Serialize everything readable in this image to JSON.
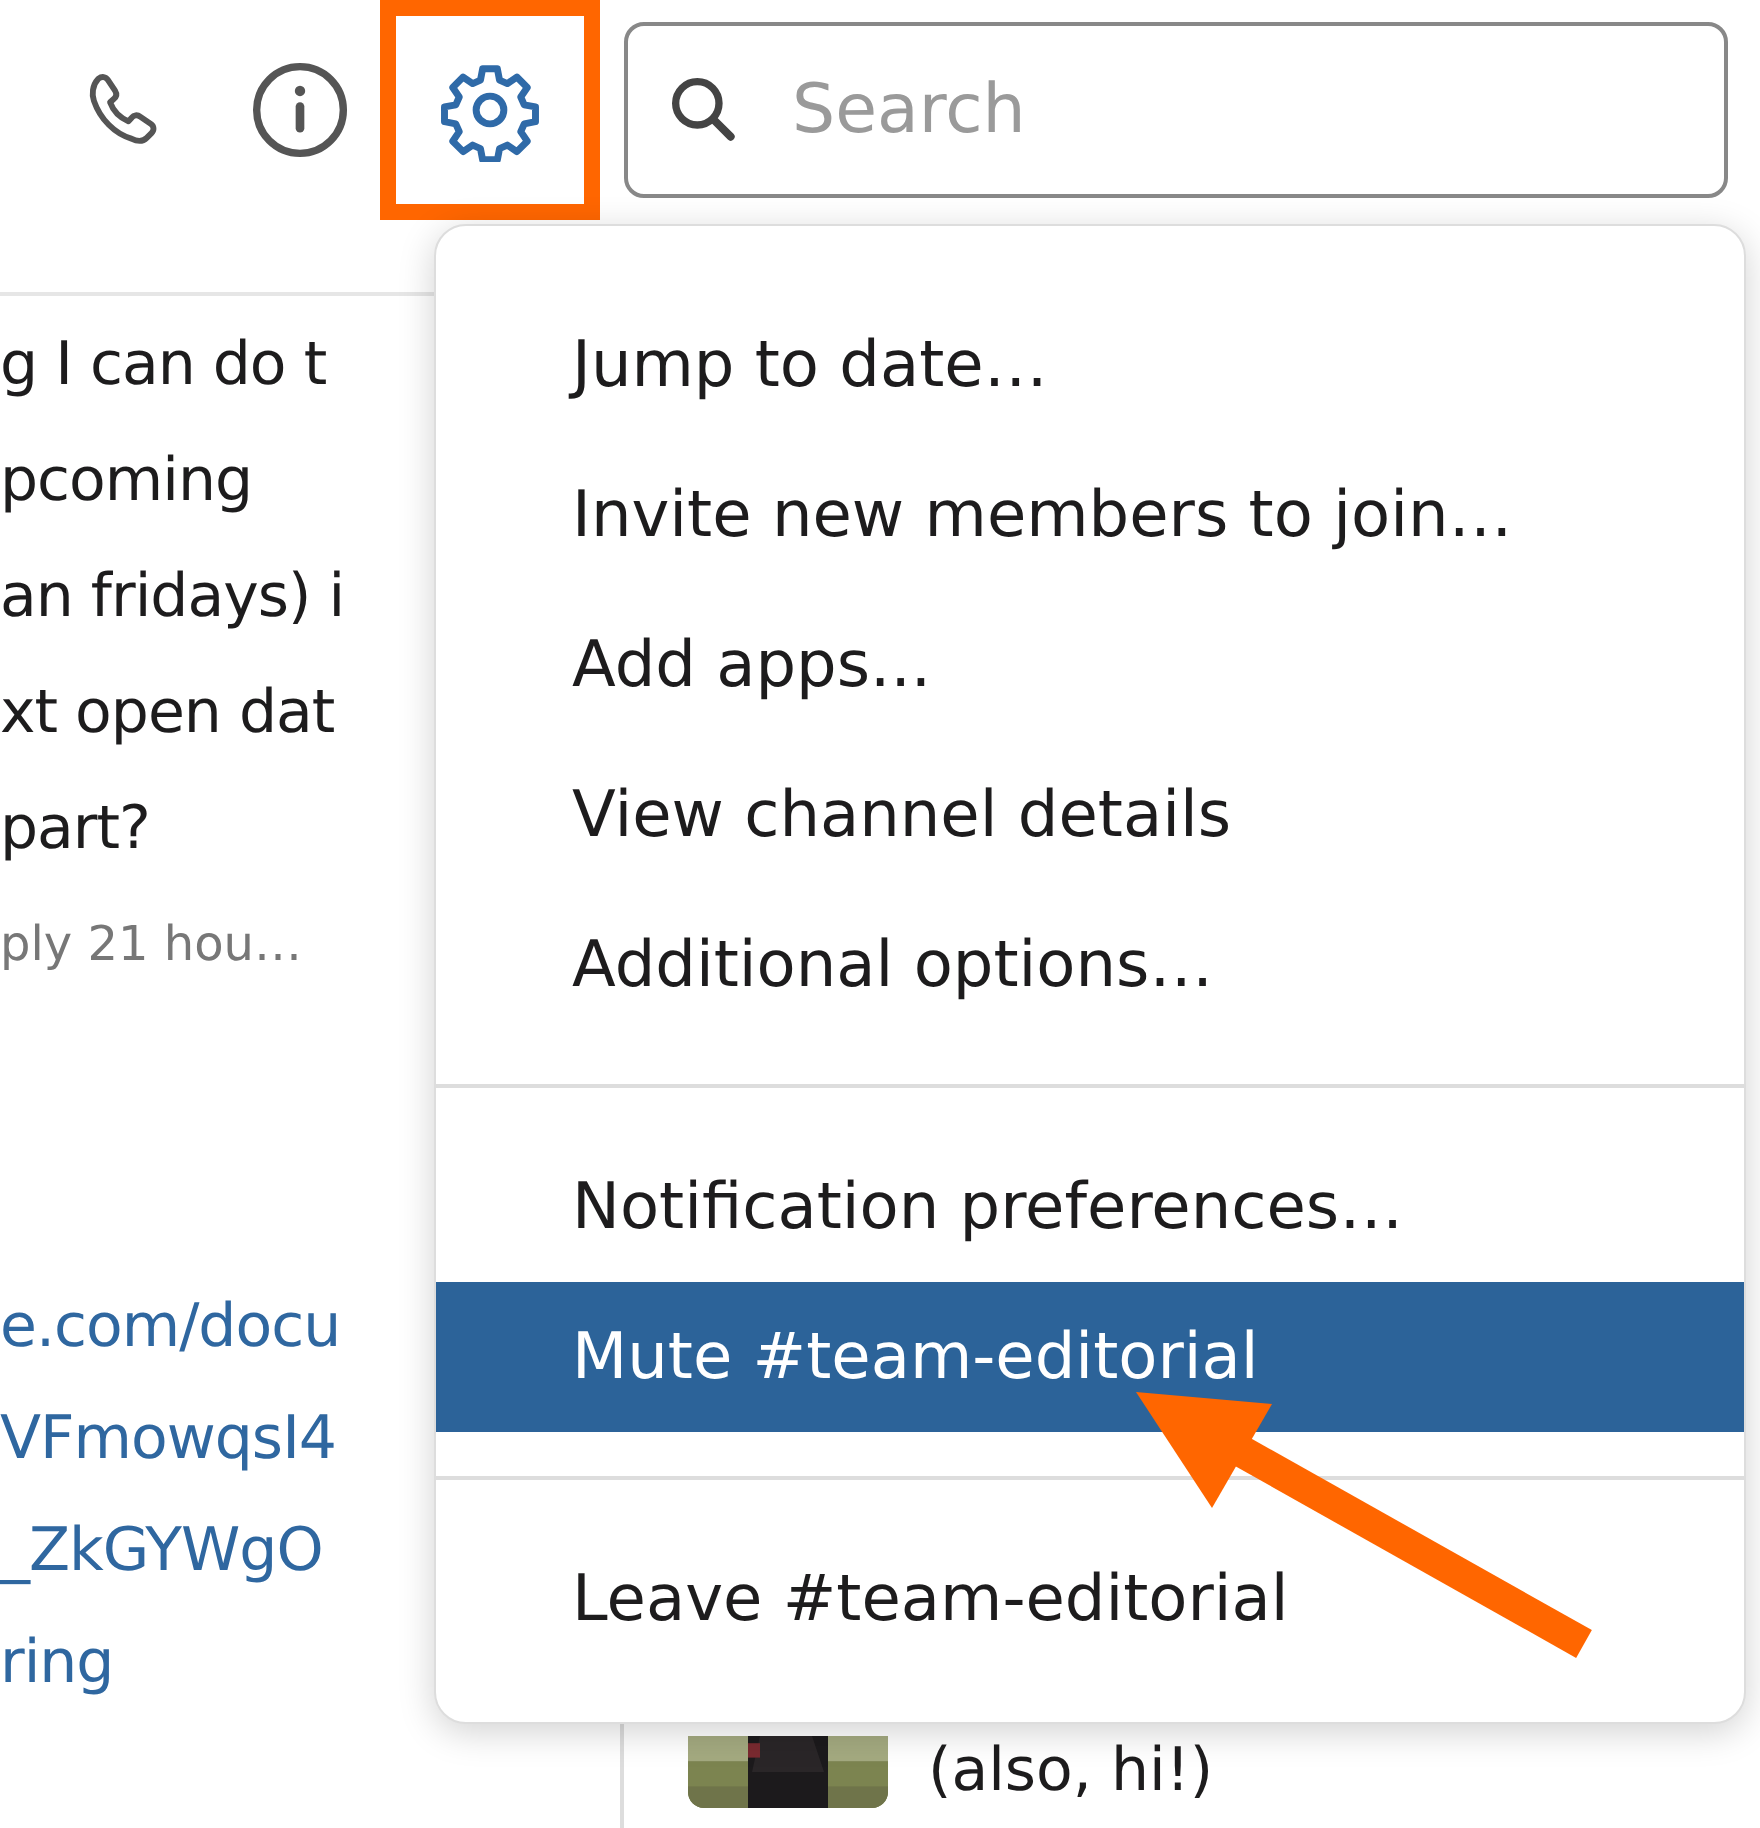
{
  "toolbar": {
    "search": {
      "placeholder": "Search"
    }
  },
  "messages": {
    "lines": [
      "g I can do t",
      "pcoming",
      "an fridays) i",
      "xt open dat",
      "part?"
    ],
    "meta": "ply 21 hou…",
    "link_lines": [
      "e.com/docu",
      "VFmowqsI4",
      "_ZkGYWgO",
      "ring"
    ]
  },
  "menu": {
    "groups": [
      [
        {
          "label": "Jump to date…",
          "selected": false
        },
        {
          "label": "Invite new members to join…",
          "selected": false
        },
        {
          "label": "Add apps...",
          "selected": false
        },
        {
          "label": "View channel details",
          "selected": false
        },
        {
          "label": "Additional options…",
          "selected": false
        }
      ],
      [
        {
          "label": "Notification preferences…",
          "selected": false
        },
        {
          "label": "Mute #team-editorial",
          "selected": true
        }
      ],
      [
        {
          "label": "Leave #team-editorial",
          "selected": false
        }
      ]
    ]
  },
  "reply_preview": {
    "text": "(also, hi!)"
  }
}
